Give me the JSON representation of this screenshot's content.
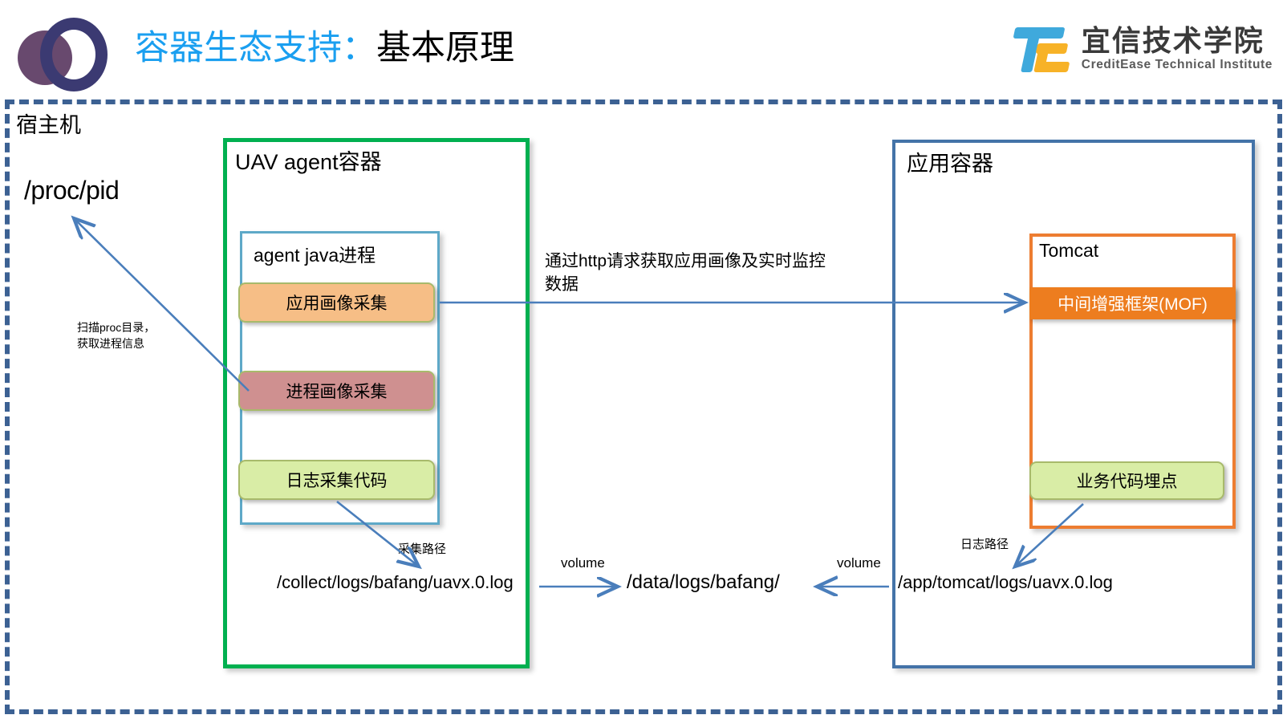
{
  "header": {
    "title_accent": "容器生态支持：",
    "title_main": "基本原理",
    "logo": {
      "cn_name": "宜信技术学院",
      "en_name": "CreditEase Technical Institute"
    }
  },
  "diagram": {
    "host": {
      "label": "宿主机",
      "proc_pid": "/proc/pid",
      "scan_note": "扫描proc目录，\n获取进程信息"
    },
    "uav_container": {
      "title": "UAV agent容器",
      "agent_java": {
        "title": "agent java进程",
        "boxes": [
          {
            "label": "应用画像采集",
            "fill": "#f6be86"
          },
          {
            "label": "进程画像采集",
            "fill": "#cf9090"
          },
          {
            "label": "日志采集代码",
            "fill": "#d9eda6"
          }
        ]
      },
      "collect_path_note": "采集路径",
      "collect_path": "/collect/logs/bafang/uavx.0.log"
    },
    "app_container": {
      "title": "应用容器",
      "tomcat": {
        "title": "Tomcat",
        "mof_label": "中间增强框架(MOF)",
        "mof_fill": "#ed7d1f",
        "biz_code_label": "业务代码埋点",
        "biz_code_fill": "#d9eda6"
      },
      "log_path_note": "日志路径",
      "log_path": "/app/tomcat/logs/uavx.0.log"
    },
    "middle": {
      "http_note": "通过http请求获取应用画像及实时监控数据",
      "volume_left": "volume",
      "volume_right": "volume",
      "shared_path": "/data/logs/bafang/"
    }
  },
  "colors": {
    "host_frame": "#3c6193",
    "uav_border": "#00b050",
    "app_border": "#4473a8",
    "tomcat_border": "#ed7d31",
    "agent_java_border": "#5ea9c8",
    "arrow": "#4a7ebb",
    "title_accent": "#1a9ff0"
  }
}
